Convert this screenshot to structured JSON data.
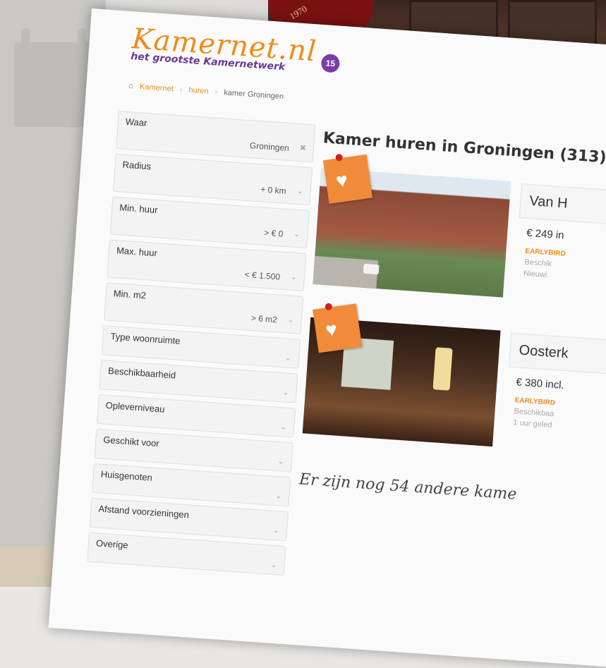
{
  "logo": {
    "name": "Kamernet.nl",
    "badge": "15",
    "tagline": "het grootste Kamernetwerk"
  },
  "breadcrumb": [
    {
      "label": "Kamernet"
    },
    {
      "label": "huren"
    },
    {
      "label": "kamer Groningen"
    }
  ],
  "filters": [
    {
      "label": "Waar",
      "value": "Groningen",
      "icon": "close-icon"
    },
    {
      "label": "Radius",
      "value": "+ 0 km",
      "icon": "chevron-down-icon"
    },
    {
      "label": "Min. huur",
      "value": "> € 0",
      "icon": "chevron-down-icon"
    },
    {
      "label": "Max. huur",
      "value": "< € 1.500",
      "icon": "chevron-down-icon"
    },
    {
      "label": "Min. m2",
      "value": "> 6 m2",
      "icon": "chevron-down-icon"
    },
    {
      "label": "Type woonruimte",
      "value": "",
      "icon": "chevron-down-icon"
    },
    {
      "label": "Beschikbaarheid",
      "value": "",
      "icon": "chevron-down-icon"
    },
    {
      "label": "Opleverniveau",
      "value": "",
      "icon": "chevron-down-icon"
    },
    {
      "label": "Geschikt voor",
      "value": "",
      "icon": "chevron-down-icon"
    },
    {
      "label": "Huisgenoten",
      "value": "",
      "icon": "chevron-down-icon"
    },
    {
      "label": "Afstand voorzieningen",
      "value": "",
      "icon": "chevron-down-icon"
    },
    {
      "label": "Overige",
      "value": "",
      "icon": "chevron-down-icon"
    }
  ],
  "main": {
    "title": "Kamer huren in Groningen (313)",
    "listings": [
      {
        "title": "Van H",
        "price": "€ 249 in",
        "badge": "EARLYBIRD",
        "meta1": "Beschik",
        "meta2": "Nieuwi"
      },
      {
        "title": "Oosterk",
        "price": "€ 380 incl.",
        "badge": "EARLYBIRD",
        "meta1": "Beschikbaa",
        "meta2": "1 uur geled"
      }
    ],
    "more_text": "Er zijn nog 54 andere kame"
  },
  "background": {
    "sign_text": "1970"
  }
}
